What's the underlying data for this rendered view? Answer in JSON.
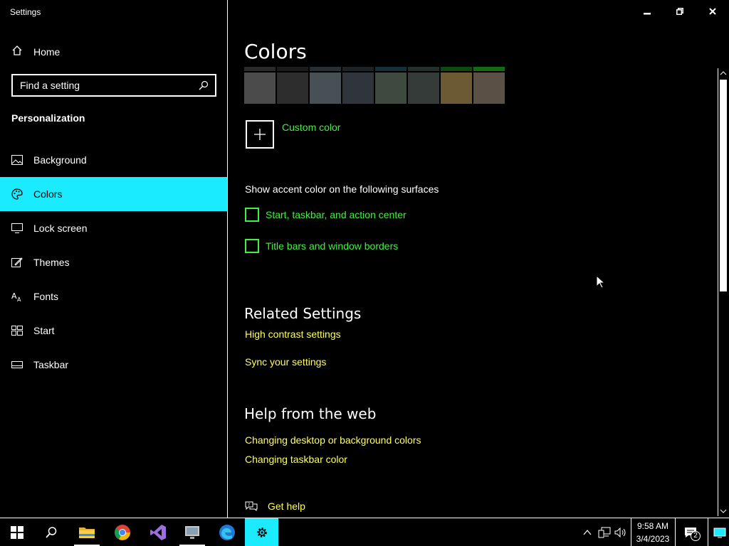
{
  "window": {
    "title": "Settings"
  },
  "sidebar": {
    "home_label": "Home",
    "search_placeholder": "Find a setting",
    "section_label": "Personalization",
    "items": [
      {
        "label": "Background",
        "icon": "image-icon"
      },
      {
        "label": "Colors",
        "icon": "palette-icon",
        "active": true
      },
      {
        "label": "Lock screen",
        "icon": "lock-screen-icon"
      },
      {
        "label": "Themes",
        "icon": "themes-icon"
      },
      {
        "label": "Fonts",
        "icon": "fonts-icon"
      },
      {
        "label": "Start",
        "icon": "start-icon"
      },
      {
        "label": "Taskbar",
        "icon": "taskbar-icon"
      }
    ]
  },
  "main": {
    "title": "Colors",
    "swatches": [
      "#4b4b4b",
      "#2d2d2d",
      "#475054",
      "#2f353a",
      "#3e4a3f",
      "#353b38",
      "#6b5a33",
      "#5a5046"
    ],
    "custom_color_label": "Custom color",
    "accent_heading": "Show accent color on the following surfaces",
    "checkboxes": [
      {
        "label": "Start, taskbar, and action center",
        "checked": false
      },
      {
        "label": "Title bars and window borders",
        "checked": false
      }
    ],
    "related": {
      "heading": "Related Settings",
      "links": [
        "High contrast settings",
        "Sync your settings"
      ]
    },
    "help": {
      "heading": "Help from the web",
      "links": [
        "Changing desktop or background colors",
        "Changing taskbar color"
      ]
    },
    "get_help_label": "Get help"
  },
  "taskbar": {
    "apps": [
      "start-icon",
      "search-icon",
      "file-explorer-icon",
      "chrome-icon",
      "visual-studio-icon",
      "remote-desktop-icon",
      "edge-icon",
      "settings-icon"
    ],
    "time": "9:58 AM",
    "date": "3/4/2023",
    "notifications_count": "2"
  },
  "colors": {
    "accent_highlight": "#1aebff",
    "link_yellow": "#ffff5a",
    "link_green": "#3ff23f"
  }
}
